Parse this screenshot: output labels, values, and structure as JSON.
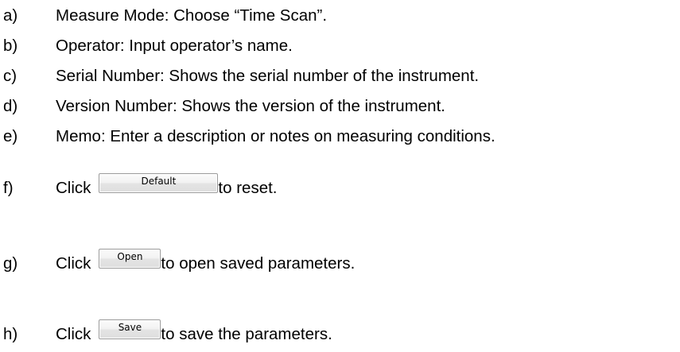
{
  "items": [
    {
      "marker": "a)",
      "text": "Measure Mode: Choose “Time Scan”."
    },
    {
      "marker": "b)",
      "text": "Operator: Input operator’s name."
    },
    {
      "marker": "c)",
      "text": "Serial Number: Shows the serial number of the instrument."
    },
    {
      "marker": "d)",
      "text": "Version Number: Shows the version of the instrument."
    },
    {
      "marker": "e)",
      "text": "Memo: Enter a description or notes on measuring conditions."
    }
  ],
  "button_items": [
    {
      "marker": "f)",
      "prefix": "Click",
      "button_label": "Default",
      "suffix": "to reset."
    },
    {
      "marker": "g)",
      "prefix": "Click",
      "button_label": "Open",
      "suffix": "to open saved parameters."
    },
    {
      "marker": "h)",
      "prefix": "Click",
      "button_label": "Save",
      "suffix": "to save the parameters."
    }
  ]
}
